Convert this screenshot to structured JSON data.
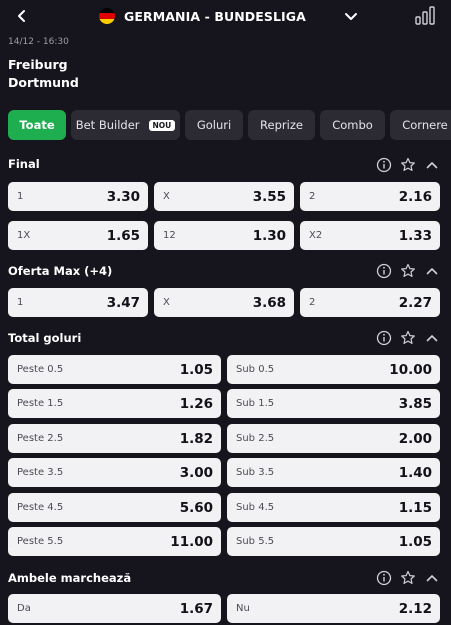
{
  "header": {
    "league": "GERMANIA - BUNDESLIGA",
    "flag_colors": [
      "#000000",
      "#dd0000",
      "#ffce00"
    ]
  },
  "match": {
    "datetime": "14/12 - 16:30",
    "home": "Freiburg",
    "away": "Dortmund"
  },
  "tabs": [
    {
      "label": "Toate",
      "active": true
    },
    {
      "label": "Bet Builder",
      "badge": "NOU"
    },
    {
      "label": "Goluri"
    },
    {
      "label": "Reprize"
    },
    {
      "label": "Combo"
    },
    {
      "label": "Cornere"
    }
  ],
  "sections": {
    "final": {
      "title": "Final",
      "rows": [
        [
          {
            "label": "1",
            "odd": "3.30"
          },
          {
            "label": "X",
            "odd": "3.55"
          },
          {
            "label": "2",
            "odd": "2.16"
          }
        ],
        [
          {
            "label": "1X",
            "odd": "1.65"
          },
          {
            "label": "12",
            "odd": "1.30"
          },
          {
            "label": "X2",
            "odd": "1.33"
          }
        ]
      ]
    },
    "oferta_max": {
      "title": "Oferta Max (+4)",
      "rows": [
        [
          {
            "label": "1",
            "odd": "3.47"
          },
          {
            "label": "X",
            "odd": "3.68"
          },
          {
            "label": "2",
            "odd": "2.27"
          }
        ]
      ]
    },
    "total_goluri": {
      "title": "Total goluri",
      "rows": [
        [
          {
            "label": "Peste 0.5",
            "odd": "1.05"
          },
          {
            "label": "Sub 0.5",
            "odd": "10.00"
          }
        ],
        [
          {
            "label": "Peste 1.5",
            "odd": "1.26"
          },
          {
            "label": "Sub 1.5",
            "odd": "3.85"
          }
        ],
        [
          {
            "label": "Peste 2.5",
            "odd": "1.82"
          },
          {
            "label": "Sub 2.5",
            "odd": "2.00"
          }
        ],
        [
          {
            "label": "Peste 3.5",
            "odd": "3.00"
          },
          {
            "label": "Sub 3.5",
            "odd": "1.40"
          }
        ],
        [
          {
            "label": "Peste 4.5",
            "odd": "5.60"
          },
          {
            "label": "Sub 4.5",
            "odd": "1.15"
          }
        ],
        [
          {
            "label": "Peste 5.5",
            "odd": "11.00"
          },
          {
            "label": "Sub 5.5",
            "odd": "1.05"
          }
        ]
      ]
    },
    "ambele": {
      "title": "Ambele marchează",
      "rows": [
        [
          {
            "label": "Da",
            "odd": "1.67"
          },
          {
            "label": "Nu",
            "odd": "2.12"
          }
        ]
      ]
    }
  },
  "icons": {
    "back": "chevron-left-icon",
    "dropdown": "chevron-down-icon",
    "stats": "bar-chart-icon",
    "info": "info-icon",
    "favorite": "star-icon",
    "collapse": "chevron-up-icon"
  }
}
